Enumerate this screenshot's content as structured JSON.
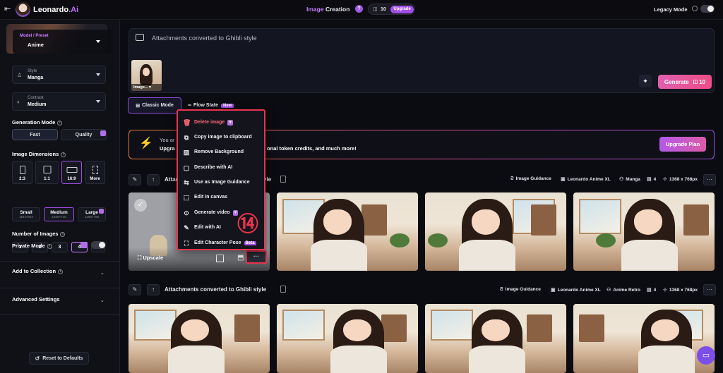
{
  "topbar": {
    "app_name": "Leonardo",
    "app_name_suffix": ".Ai",
    "title_prefix": "Image",
    "title_rest": " Creation",
    "tokens": "10",
    "upgrade": "Upgrade",
    "legacy_mode": "Legacy Mode"
  },
  "sidebar": {
    "model_label": "Model / Preset",
    "model_value": "Anime",
    "style_label": "Style",
    "style_value": "Manga",
    "contrast_label": "Contrast",
    "contrast_value": "Medium",
    "generation_mode": "Generation Mode",
    "fast": "Fast",
    "quality": "Quality",
    "image_dimensions": "Image Dimensions",
    "dims": [
      "2:3",
      "1:1",
      "16:9",
      "More"
    ],
    "sizes": [
      {
        "label": "Small",
        "sub": "1184×664"
      },
      {
        "label": "Medium",
        "sub": "1280×720"
      },
      {
        "label": "Large",
        "sub": "1368×768"
      }
    ],
    "number_of_images": "Number of Images",
    "counts": [
      "1",
      "2",
      "3",
      "4"
    ],
    "private_mode": "Private Mode",
    "add_to_collection": "Add to Collection",
    "advanced_settings": "Advanced Settings",
    "reset": "Reset to Defaults"
  },
  "prompt": {
    "text": "Attachments converted to Ghibli style",
    "attachment_label": "Image...",
    "generate": "Generate",
    "generate_cost": "10"
  },
  "modes": {
    "classic": "Classic Mode",
    "flow": "Flow State",
    "new_badge": "New"
  },
  "upgrade_banner": {
    "line1": "You ar",
    "line2": "Upgra",
    "line_end": "onal token credits, and much more!",
    "button": "Upgrade Plan"
  },
  "gen1": {
    "title": "Attac",
    "title_tail": "yle",
    "chips": [
      "Image Guidance",
      "Leonardo Anime XL",
      "Manga",
      "4",
      "1368 x 768px"
    ],
    "upscale": "Upscale"
  },
  "gen2": {
    "title": "Attachments converted to Ghibli style",
    "chips": [
      "Image Guidance",
      "Leonardo Anime XL",
      "Anime Retro",
      "4",
      "1368 x 768px"
    ]
  },
  "context_menu": {
    "items": [
      {
        "label": "Delete image",
        "icon": "trash-icon",
        "badge": true
      },
      {
        "label": "Copy image to clipboard",
        "icon": "copy-icon"
      },
      {
        "label": "Remove Background",
        "icon": "remove-bg-icon"
      },
      {
        "label": "Describe with AI",
        "icon": "describe-icon"
      },
      {
        "label": "Use as Image Guidance",
        "icon": "guidance-icon"
      },
      {
        "label": "Edit in canvas",
        "icon": "canvas-icon"
      },
      {
        "label": "Generate video",
        "icon": "video-icon",
        "badge": true
      },
      {
        "label": "Edit with AI",
        "icon": "edit-ai-icon"
      },
      {
        "label": "Edit Character Pose",
        "icon": "pose-icon",
        "beta": "Beta"
      }
    ]
  },
  "annotation": {
    "step": "⑭"
  },
  "colors": {
    "accent": "#e8589d",
    "purple": "#a24ee8",
    "danger": "#ff3a5c"
  }
}
